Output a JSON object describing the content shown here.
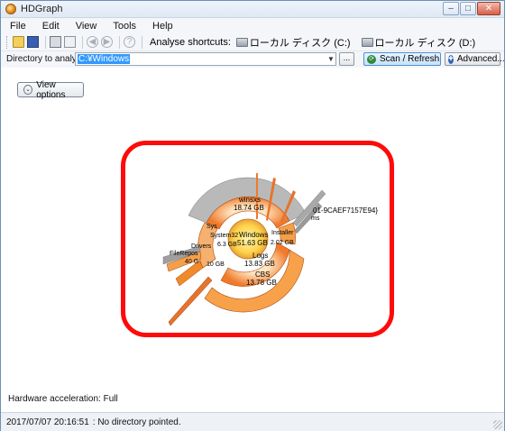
{
  "window": {
    "title": "HDGraph"
  },
  "menu": {
    "items": [
      "File",
      "Edit",
      "View",
      "Tools",
      "Help"
    ]
  },
  "toolbar": {
    "shortcut_label": "Analyse shortcuts:",
    "drives": [
      {
        "label": "ローカル ディスク (C:)"
      },
      {
        "label": "ローカル ディスク (D:)"
      }
    ]
  },
  "directory": {
    "label": "Directory to analyze :",
    "value": "C:¥Windows",
    "browse_label": "...",
    "scan_label": "Scan / Refresh",
    "advanced_label": "Advanced..."
  },
  "view_options": {
    "label": "View options"
  },
  "sunburst": {
    "labels": {
      "winsxs": "winsxs",
      "winsxs_size": "18.74 GB",
      "root": "Windows",
      "root_size": "51.63 GB",
      "logs": "Logs",
      "logs_size": "13.83 GB",
      "cbs": "CBS",
      "cbs_size": "13.78 GB",
      "installer_size": "2.02 GB",
      "installer": "Installer",
      "system32": "System32",
      "sys": "Sys",
      "drivers": "Drivers",
      "filerepo": "FileRepos",
      "guid": "01-9CAEF7157E94}",
      "misc_size": "40 G",
      "ten_size": "10 GB",
      "ms": "ms",
      "s63": "6.3 GB"
    }
  },
  "hardware_acceleration": "Hardware acceleration: Full",
  "status": {
    "timestamp": "2017/07/07 20:16:51",
    "message": ": No directory pointed."
  },
  "colors": {
    "highlight": "#ff0a0a",
    "center": "#ffd24a",
    "ring_orange": "#f08a2a",
    "ring_gray": "#a8a8a8"
  }
}
